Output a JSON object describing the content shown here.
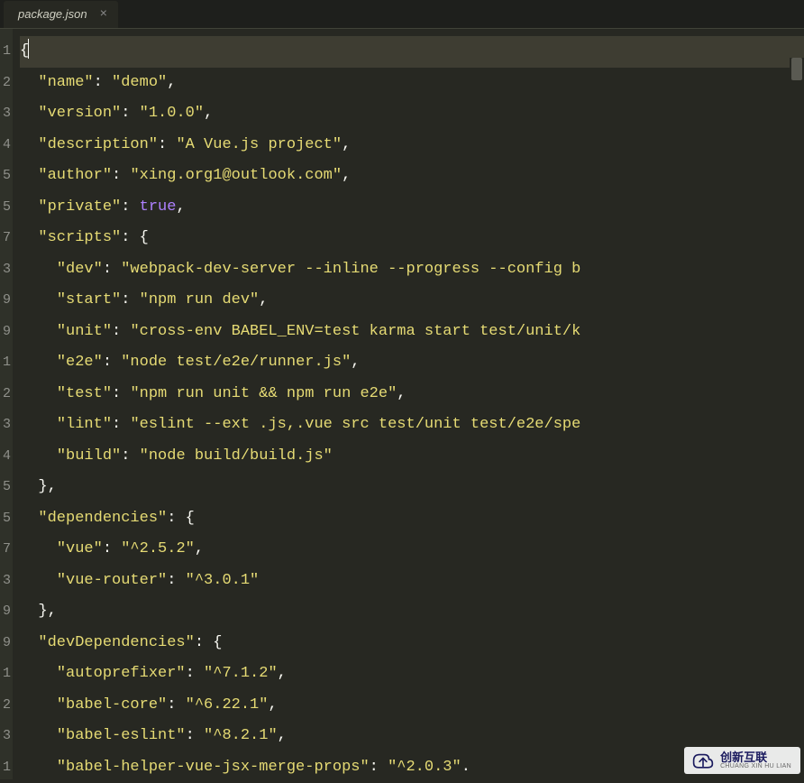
{
  "tab": {
    "name": "package.json",
    "close": "×"
  },
  "gutter_visible": [
    "1",
    "2",
    "3",
    "4",
    "5",
    "5",
    "7",
    "3",
    "9",
    "9",
    "1",
    "2",
    "3",
    "4",
    "5",
    "5",
    "7",
    "3",
    "9",
    "9",
    "1",
    "2",
    "3",
    "1"
  ],
  "lines": [
    {
      "active": true,
      "tokens": [
        [
          "punc",
          "{"
        ],
        [
          "cursor",
          ""
        ]
      ]
    },
    {
      "tokens": [
        [
          "punc",
          "  "
        ],
        [
          "key",
          "\"name\""
        ],
        [
          "punc",
          ": "
        ],
        [
          "str",
          "\"demo\""
        ],
        [
          "punc",
          ","
        ]
      ]
    },
    {
      "tokens": [
        [
          "punc",
          "  "
        ],
        [
          "key",
          "\"version\""
        ],
        [
          "punc",
          ": "
        ],
        [
          "str",
          "\"1.0.0\""
        ],
        [
          "punc",
          ","
        ]
      ]
    },
    {
      "tokens": [
        [
          "punc",
          "  "
        ],
        [
          "key",
          "\"description\""
        ],
        [
          "punc",
          ": "
        ],
        [
          "str",
          "\"A Vue.js project\""
        ],
        [
          "punc",
          ","
        ]
      ]
    },
    {
      "tokens": [
        [
          "punc",
          "  "
        ],
        [
          "key",
          "\"author\""
        ],
        [
          "punc",
          ": "
        ],
        [
          "str",
          "\"xing.org1@outlook.com\""
        ],
        [
          "punc",
          ","
        ]
      ]
    },
    {
      "tokens": [
        [
          "punc",
          "  "
        ],
        [
          "key",
          "\"private\""
        ],
        [
          "punc",
          ": "
        ],
        [
          "bool",
          "true"
        ],
        [
          "punc",
          ","
        ]
      ]
    },
    {
      "tokens": [
        [
          "punc",
          "  "
        ],
        [
          "key",
          "\"scripts\""
        ],
        [
          "punc",
          ": {"
        ]
      ]
    },
    {
      "tokens": [
        [
          "punc",
          "    "
        ],
        [
          "key",
          "\"dev\""
        ],
        [
          "punc",
          ": "
        ],
        [
          "str",
          "\"webpack-dev-server --inline --progress --config b"
        ]
      ]
    },
    {
      "tokens": [
        [
          "punc",
          "    "
        ],
        [
          "key",
          "\"start\""
        ],
        [
          "punc",
          ": "
        ],
        [
          "str",
          "\"npm run dev\""
        ],
        [
          "punc",
          ","
        ]
      ]
    },
    {
      "tokens": [
        [
          "punc",
          "    "
        ],
        [
          "key",
          "\"unit\""
        ],
        [
          "punc",
          ": "
        ],
        [
          "str",
          "\"cross-env BABEL_ENV=test karma start test/unit/k"
        ]
      ]
    },
    {
      "tokens": [
        [
          "punc",
          "    "
        ],
        [
          "key",
          "\"e2e\""
        ],
        [
          "punc",
          ": "
        ],
        [
          "str",
          "\"node test/e2e/runner.js\""
        ],
        [
          "punc",
          ","
        ]
      ]
    },
    {
      "tokens": [
        [
          "punc",
          "    "
        ],
        [
          "key",
          "\"test\""
        ],
        [
          "punc",
          ": "
        ],
        [
          "str",
          "\"npm run unit && npm run e2e\""
        ],
        [
          "punc",
          ","
        ]
      ]
    },
    {
      "tokens": [
        [
          "punc",
          "    "
        ],
        [
          "key",
          "\"lint\""
        ],
        [
          "punc",
          ": "
        ],
        [
          "str",
          "\"eslint --ext .js,.vue src test/unit test/e2e/spe"
        ]
      ]
    },
    {
      "tokens": [
        [
          "punc",
          "    "
        ],
        [
          "key",
          "\"build\""
        ],
        [
          "punc",
          ": "
        ],
        [
          "str",
          "\"node build/build.js\""
        ]
      ]
    },
    {
      "tokens": [
        [
          "punc",
          "  },"
        ]
      ]
    },
    {
      "tokens": [
        [
          "punc",
          "  "
        ],
        [
          "key",
          "\"dependencies\""
        ],
        [
          "punc",
          ": {"
        ]
      ]
    },
    {
      "tokens": [
        [
          "punc",
          "    "
        ],
        [
          "key",
          "\"vue\""
        ],
        [
          "punc",
          ": "
        ],
        [
          "str",
          "\"^2.5.2\""
        ],
        [
          "punc",
          ","
        ]
      ]
    },
    {
      "tokens": [
        [
          "punc",
          "    "
        ],
        [
          "key",
          "\"vue-router\""
        ],
        [
          "punc",
          ": "
        ],
        [
          "str",
          "\"^3.0.1\""
        ]
      ]
    },
    {
      "tokens": [
        [
          "punc",
          "  },"
        ]
      ]
    },
    {
      "tokens": [
        [
          "punc",
          "  "
        ],
        [
          "key",
          "\"devDependencies\""
        ],
        [
          "punc",
          ": {"
        ]
      ]
    },
    {
      "tokens": [
        [
          "punc",
          "    "
        ],
        [
          "key",
          "\"autoprefixer\""
        ],
        [
          "punc",
          ": "
        ],
        [
          "str",
          "\"^7.1.2\""
        ],
        [
          "punc",
          ","
        ]
      ]
    },
    {
      "tokens": [
        [
          "punc",
          "    "
        ],
        [
          "key",
          "\"babel-core\""
        ],
        [
          "punc",
          ": "
        ],
        [
          "str",
          "\"^6.22.1\""
        ],
        [
          "punc",
          ","
        ]
      ]
    },
    {
      "tokens": [
        [
          "punc",
          "    "
        ],
        [
          "key",
          "\"babel-eslint\""
        ],
        [
          "punc",
          ": "
        ],
        [
          "str",
          "\"^8.2.1\""
        ],
        [
          "punc",
          ","
        ]
      ]
    },
    {
      "tokens": [
        [
          "punc",
          "    "
        ],
        [
          "key",
          "\"babel-helper-vue-jsx-merge-props\""
        ],
        [
          "punc",
          ": "
        ],
        [
          "str",
          "\"^2.0.3\""
        ],
        [
          "punc",
          "."
        ]
      ]
    }
  ],
  "watermark": {
    "cn": "创新互联",
    "en": "CHUANG XIN HU LIAN"
  }
}
